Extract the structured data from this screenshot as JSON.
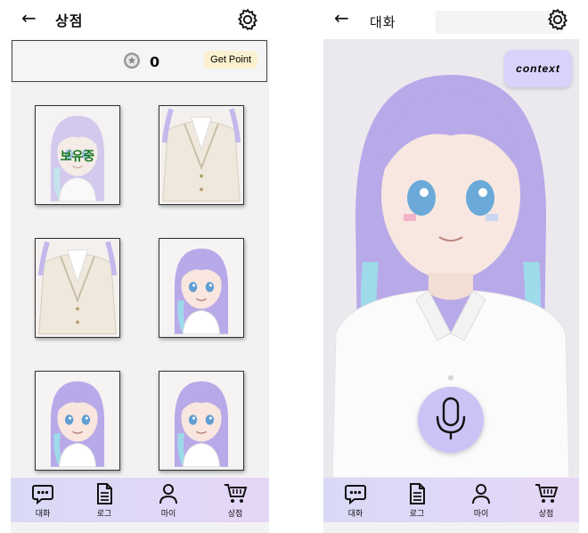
{
  "shop": {
    "title": "상점",
    "points": "0",
    "get_point_label": "Get Point",
    "owned_label": "보유중"
  },
  "chat": {
    "title": "대화",
    "context_label": "context"
  },
  "nav": [
    {
      "label": "대화",
      "icon": "chat-icon"
    },
    {
      "label": "로그",
      "icon": "document-icon"
    },
    {
      "label": "마이",
      "icon": "person-icon"
    },
    {
      "label": "상점",
      "icon": "cart-icon"
    }
  ],
  "colors": {
    "nav_bg": "#d9d9f6",
    "context_button": "#d7d3fa",
    "mic_button": "#cac4f6",
    "get_point_bg": "#fbf0cf",
    "owned_text": "#16771e",
    "hair": "#b4a6e8"
  }
}
